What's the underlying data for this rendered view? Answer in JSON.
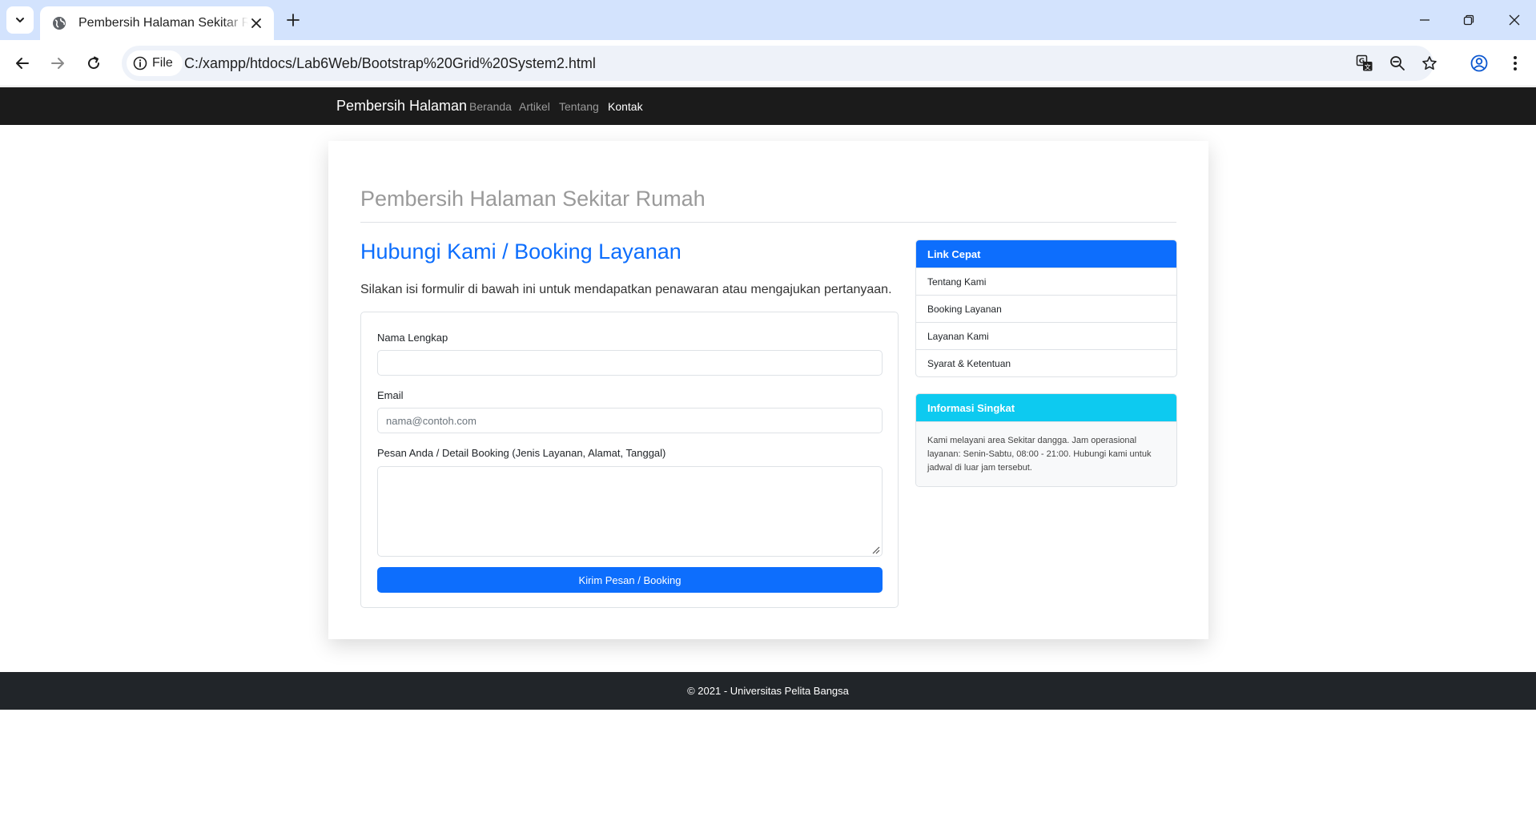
{
  "browser": {
    "tab_title": "Pembersih Halaman Sekitar Rumah",
    "site_chip": "File",
    "url": "C:/xampp/htdocs/Lab6Web/Bootstrap%20Grid%20System2.html"
  },
  "navbar": {
    "brand": "Pembersih Halaman",
    "links": [
      "Beranda",
      "Artikel",
      "Tentang",
      "Kontak"
    ],
    "active": "Kontak"
  },
  "header": {
    "title": "Pembersih Halaman Sekitar Rumah"
  },
  "contact": {
    "title": "Hubungi Kami / Booking Layanan",
    "lead": "Silakan isi formulir di bawah ini untuk mendapatkan penawaran atau mengajukan pertanyaan.",
    "name_label": "Nama Lengkap",
    "name_value": "",
    "email_label": "Email",
    "email_placeholder": "nama@contoh.com",
    "message_label": "Pesan Anda / Detail Booking (Jenis Layanan, Alamat, Tanggal)",
    "message_value": "",
    "submit_label": "Kirim Pesan / Booking"
  },
  "sidebar": {
    "quick_links_title": "Link Cepat",
    "quick_links": [
      "Tentang Kami",
      "Booking Layanan",
      "Layanan Kami",
      "Syarat & Ketentuan"
    ],
    "info_title": "Informasi Singkat",
    "info_text": "Kami melayani area Sekitar dangga. Jam operasional layanan: Senin-Sabtu, 08:00 - 21:00. Hubungi kami untuk jadwal di luar jam tersebut."
  },
  "footer": {
    "text": "© 2021 - Universitas Pelita Bangsa"
  },
  "colors": {
    "primary": "#0d6efd",
    "info": "#0dcaf0",
    "navbar": "#1b1b1b",
    "footer": "#212529",
    "tabstrip": "#d3e3fd"
  }
}
